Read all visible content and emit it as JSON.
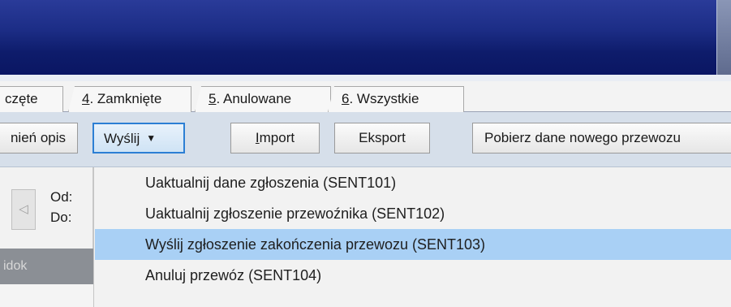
{
  "tabs": [
    {
      "label": "częte"
    },
    {
      "label_prefix": "",
      "label_mnemonic": "4",
      "label_rest": ". Zamknięte"
    },
    {
      "label_prefix": "",
      "label_mnemonic": "5",
      "label_rest": ". Anulowane"
    },
    {
      "label_prefix": "",
      "label_mnemonic": "6",
      "label_rest": ". Wszystkie"
    }
  ],
  "toolbar": {
    "change_desc_label": "nień opis",
    "send_label": "Wyślij",
    "send_caret": "▼",
    "import_mnemonic": "I",
    "import_rest": "mport",
    "export_label": "Eksport",
    "fetch_label": "Pobierz dane nowego przewozu"
  },
  "filters": {
    "from_label": "Od:",
    "to_label": "Do:",
    "nav_arrow": "◁"
  },
  "view_label": "idok",
  "menu": {
    "items": [
      {
        "label": "Uaktualnij dane zgłoszenia (SENT101)"
      },
      {
        "label": "Uaktualnij zgłoszenie przewoźnika (SENT102)"
      },
      {
        "label": "Wyślij zgłoszenie zakończenia przewozu (SENT103)"
      },
      {
        "label": "Anuluj przewóz (SENT104)"
      }
    ],
    "active_index": 2
  },
  "colors": {
    "title_band": "#1c2d86",
    "menu_highlight": "#a9d0f5",
    "send_button_border": "#2c7fd4"
  }
}
